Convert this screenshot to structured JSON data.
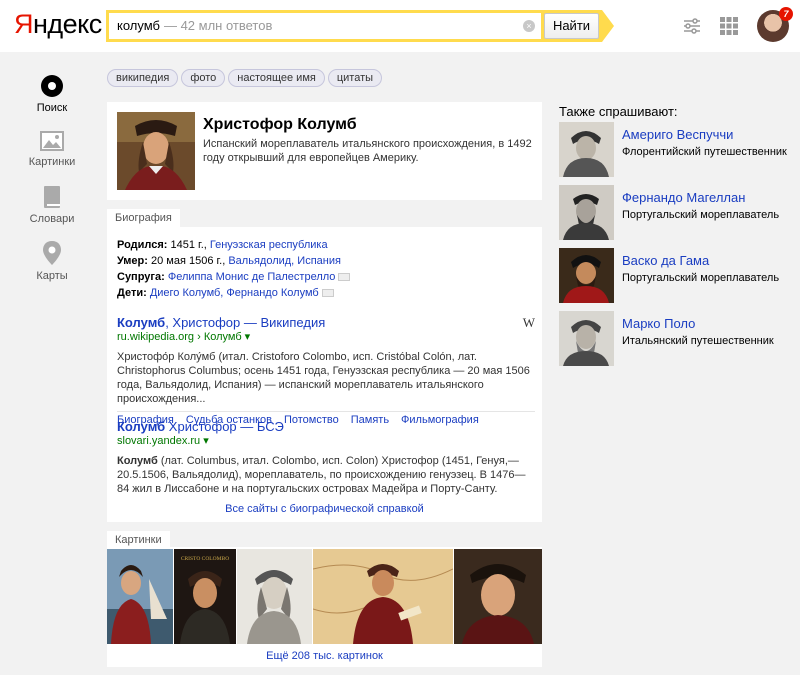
{
  "header": {
    "logo_first": "Я",
    "logo_rest": "ндекс",
    "search_query": "колумб",
    "search_hint": "— 42 млн ответов",
    "clear_icon": "×",
    "search_button": "Найти",
    "notifications_count": "7",
    "accent_color": "#ffdb4d",
    "brand_color": "#e61400"
  },
  "nav": {
    "items": [
      {
        "label": "Поиск",
        "icon": "search-icon",
        "active": true
      },
      {
        "label": "Картинки",
        "icon": "images-icon",
        "active": false
      },
      {
        "label": "Словари",
        "icon": "dictionary-icon",
        "active": false
      },
      {
        "label": "Карты",
        "icon": "map-pin-icon",
        "active": false
      }
    ]
  },
  "tags": [
    "википедия",
    "фото",
    "настоящее имя",
    "цитаты"
  ],
  "entity": {
    "title": "Христофор Колумб",
    "description": "Испанский мореплаватель итальянского происхождения, в 1492 году открывший для европейцев Америку."
  },
  "biography": {
    "tab": "Биография",
    "born_key": "Родился:",
    "born_value": " 1451 г., ",
    "born_link": "Генуэзская республика",
    "died_key": "Умер:",
    "died_value": " 20 мая 1506 г., ",
    "died_link": "Вальядолид, Испания",
    "spouse_key": "Супруга:",
    "spouse_link": "Фелиппа Мониc де Палестрелло",
    "children_key": "Дети:",
    "children_link": "Диего Колумб, Фернандо Колумб"
  },
  "results": [
    {
      "title_bold": "Колумб",
      "title_rest": ", Христофор — Википедия",
      "url": "ru.wikipedia.org › Колумб ▾",
      "badge": "W",
      "snippet": "Христофо́р Колу́мб (итал. Cristoforo Colombo, исп. Cristóbal Colón, лат. Christophorus Columbus; осень 1451 года, Генуэзская республика — 20 мая 1506 года, Вальядолид, Испания) — испанский мореплаватель итальянского происхождения...",
      "sublinks": [
        "Биография",
        "Судьба останков",
        "Потомство",
        "Память",
        "Фильмография"
      ]
    },
    {
      "title_bold": "Колумб",
      "title_rest": " Христофор — БСЭ",
      "url": "slovari.yandex.ru ▾",
      "snippet_bold": "Колумб",
      "snippet": " (лат. Columbus, итал. Colombo, исп. Colon) Христофор (1451, Генуя,—20.5.1506, Вальядолид), мореплаватель, по происхождению генуэзец. В 1476—84 жил в Лиссабоне и на португальских островах Мадейра и Порту-Санту."
    }
  ],
  "all_sites_link": "Все сайты с биографической справкой",
  "images": {
    "tab": "Картинки",
    "thumb2_caption": "CRISTO COLOMBO",
    "more_link": "Ещё 208 тыс. картинок"
  },
  "also_asked": {
    "title": "Также спрашивают:",
    "items": [
      {
        "name": "Америго Веспуччи",
        "desc": "Флорентийский путешественник"
      },
      {
        "name": "Фернандо Магеллан",
        "desc": "Португальский мореплаватель"
      },
      {
        "name": "Васко да Гама",
        "desc": "Португальский мореплаватель"
      },
      {
        "name": "Марко Поло",
        "desc": "Итальянский путешественник"
      }
    ]
  }
}
